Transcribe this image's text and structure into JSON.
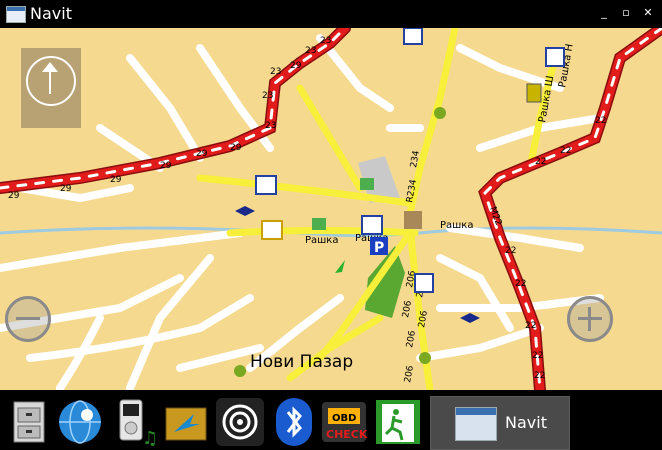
{
  "window": {
    "title": "Navit",
    "minimize": "_",
    "maximize": "▫",
    "close": "✕"
  },
  "map": {
    "city_label": "Нови Пазар",
    "street_labels": [
      "Рашка",
      "Рашка",
      "Рашка",
      "R234",
      "Рашка Ш",
      "Рашка Н"
    ],
    "road_numbers": [
      "29",
      "29",
      "29",
      "29",
      "29",
      "29",
      "29",
      "23",
      "23",
      "23",
      "23",
      "23",
      "22",
      "22",
      "22",
      "22",
      "22",
      "22",
      "22",
      "22",
      "206",
      "206",
      "206",
      "206",
      "206",
      "206",
      "234",
      "R234",
      "M22"
    ]
  },
  "taskbar": {
    "apps": [
      {
        "name": "file-cabinet"
      },
      {
        "name": "settings-globe"
      },
      {
        "name": "media-player"
      },
      {
        "name": "navigation"
      },
      {
        "name": "wireless"
      },
      {
        "name": "bluetooth"
      },
      {
        "name": "obd-check"
      },
      {
        "name": "exit"
      }
    ],
    "active_window_label": "Navit"
  },
  "colors": {
    "map_bg": "#f5d98f",
    "major_road": "#e21b1b",
    "road_yellow": "#f7ef3a",
    "road_white": "#ffffff"
  }
}
